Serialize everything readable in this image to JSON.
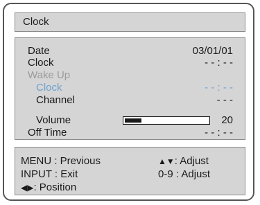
{
  "title": "Clock",
  "rows": {
    "date": {
      "label": "Date",
      "value": "03/01/01"
    },
    "clock": {
      "label": "Clock",
      "value": "- - : - -"
    },
    "wake_up": {
      "label": "Wake Up"
    },
    "wake_clock": {
      "label": "Clock",
      "value": "- - : - -"
    },
    "channel": {
      "label": "Channel",
      "value": "- - -"
    },
    "volume": {
      "label": "Volume",
      "value": "20",
      "level_fraction": 0.2
    },
    "off_time": {
      "label": "Off Time",
      "value": "- - : - -"
    }
  },
  "help": {
    "menu": "MENU : Previous",
    "input": "INPUT : Exit",
    "position_icon": "left-right-arrows",
    "position": ": Position",
    "adjust_icon": "up-down-arrows",
    "adjust": ": Adjust",
    "digits": "0-9 : Adjust"
  },
  "colors": {
    "panel": "#d5d5d5",
    "highlight": "#6fa2cf",
    "disabled": "#9a9a9a"
  }
}
